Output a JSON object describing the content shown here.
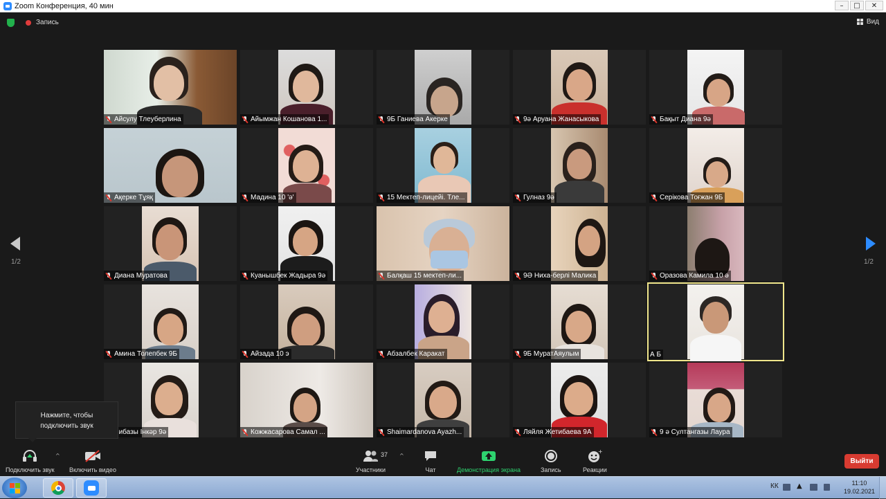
{
  "window": {
    "title": "Zoom Конференция, 40 мин",
    "controls": [
      "–",
      "□",
      "✕"
    ]
  },
  "topbar": {
    "recording_label": "Запись",
    "view_label": "Вид"
  },
  "pagination": {
    "left_page": "1/2",
    "right_page": "1/2"
  },
  "participants": [
    {
      "name": "Айсулу Тлеуберлина"
    },
    {
      "name": "Айымжан Кошанова 1..."
    },
    {
      "name": "9Б Ганиева Акерке"
    },
    {
      "name": "9ә Аруана Жанасыкова"
    },
    {
      "name": "Бақыт Диана 9ә"
    },
    {
      "name": "Ақерке Тұяқ"
    },
    {
      "name": "Мадина 10 'ә'"
    },
    {
      "name": "15 Мектеп-лицейі. Тле..."
    },
    {
      "name": "Гулназ 9ә"
    },
    {
      "name": "Серікова Тоғжан 9Б"
    },
    {
      "name": "Диана Муратова"
    },
    {
      "name": "Куанышбек Жадыра 9ә"
    },
    {
      "name": "Балқаш 15 мектеп-ли..."
    },
    {
      "name": "9Ә Ниха-берлі Малика"
    },
    {
      "name": "Оразова Камила 10 ә"
    },
    {
      "name": "Амина Толепбек 9Б"
    },
    {
      "name": "Айзада 10 э"
    },
    {
      "name": "Абзалбек Каракат"
    },
    {
      "name": "9Б МуратАяулым"
    },
    {
      "name": "А Б"
    },
    {
      "name": "Бибазы Інкәр 9ә"
    },
    {
      "name": "Кожжасарова Самал ..."
    },
    {
      "name": "Shaimardanova Ayazh..."
    },
    {
      "name": "Ляйля Жетибаева 9А"
    },
    {
      "name": "9 ә Султангазы Лаура"
    }
  ],
  "tooltip": {
    "line1": "Нажмите, чтобы",
    "line2": "подключить звук"
  },
  "toolbar": {
    "audio_label": "Подключить звук",
    "video_label": "Включить видео",
    "participants_label": "Участники",
    "participants_count": "37",
    "chat_label": "Чат",
    "share_label": "Демонстрация экрана",
    "record_label": "Запись",
    "reactions_label": "Реакции",
    "leave_label": "Выйти"
  },
  "taskbar": {
    "lang": "КК",
    "time": "11:10",
    "date": "19.02.2021"
  },
  "colors": {
    "accent_green": "#2ed36f",
    "leave_red": "#d83b31",
    "active_speaker": "#f0e68c",
    "zoom_blue": "#2d8cff"
  }
}
